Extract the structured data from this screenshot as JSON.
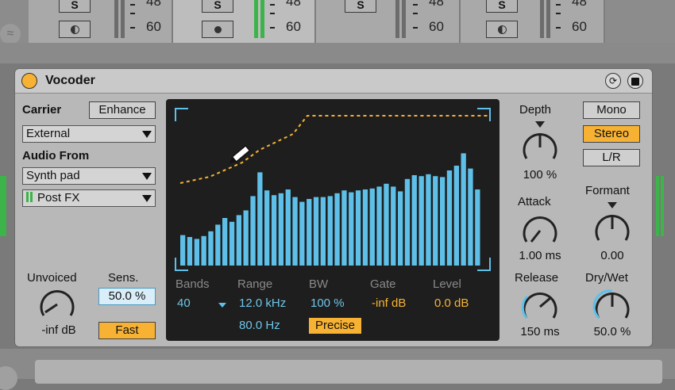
{
  "mixer": {
    "strips": [
      {
        "solo_label": "S",
        "db_top": "48",
        "db_bottom": "60",
        "mode": "half-moon",
        "meter_color": "grey"
      },
      {
        "solo_label": "S",
        "db_top": "48",
        "db_bottom": "60",
        "mode": "dot",
        "meter_color": "green"
      },
      {
        "solo_label": "S",
        "db_top": "48",
        "db_bottom": "60",
        "mode": "none",
        "meter_color": "grey"
      },
      {
        "solo_label": "S",
        "db_top": "48",
        "db_bottom": "60",
        "mode": "half-moon",
        "meter_color": "grey"
      }
    ]
  },
  "device": {
    "title": "Vocoder",
    "carrier_label": "Carrier",
    "enhance_label": "Enhance",
    "carrier_value": "External",
    "audio_from_label": "Audio From",
    "audio_from_value": "Synth pad",
    "post_fx_value": "Post FX",
    "unvoiced_label": "Unvoiced",
    "unvoiced_value": "-inf dB",
    "sens_label": "Sens.",
    "sens_value": "50.0 %",
    "fast_label": "Fast",
    "depth_label": "Depth",
    "depth_value": "100 %",
    "attack_label": "Attack",
    "attack_value": "1.00 ms",
    "release_label": "Release",
    "release_value": "150 ms",
    "mono_label": "Mono",
    "stereo_label": "Stereo",
    "lr_label": "L/R",
    "formant_label": "Formant",
    "formant_value": "0.00",
    "drywet_label": "Dry/Wet",
    "drywet_value": "50.0 %",
    "display": {
      "bands_label": "Bands",
      "bands_value": "40",
      "range_label": "Range",
      "range_high": "12.0 kHz",
      "range_low": "80.0 Hz",
      "bw_label": "BW",
      "bw_value": "100 %",
      "precise_label": "Precise",
      "gate_label": "Gate",
      "gate_value": "-inf dB",
      "level_label": "Level",
      "level_value": "0.0 dB",
      "band_levels": [
        0.32,
        0.3,
        0.28,
        0.31,
        0.36,
        0.43,
        0.5,
        0.46,
        0.53,
        0.58,
        0.73,
        0.98,
        0.79,
        0.74,
        0.76,
        0.8,
        0.72,
        0.67,
        0.7,
        0.72,
        0.72,
        0.73,
        0.76,
        0.79,
        0.77,
        0.79,
        0.8,
        0.81,
        0.83,
        0.86,
        0.83,
        0.78,
        0.91,
        0.95,
        0.94,
        0.96,
        0.94,
        0.93,
        1.0,
        1.05,
        1.18,
        1.02,
        0.8
      ],
      "colors": {
        "bar": "#5ec0e8",
        "curve": "#f7b234",
        "frame": "#5ec0e8"
      }
    }
  },
  "colors": {
    "accent": "#f7b234",
    "display_bg": "#1e1e1e",
    "active_arc": "#5ec0e8"
  }
}
